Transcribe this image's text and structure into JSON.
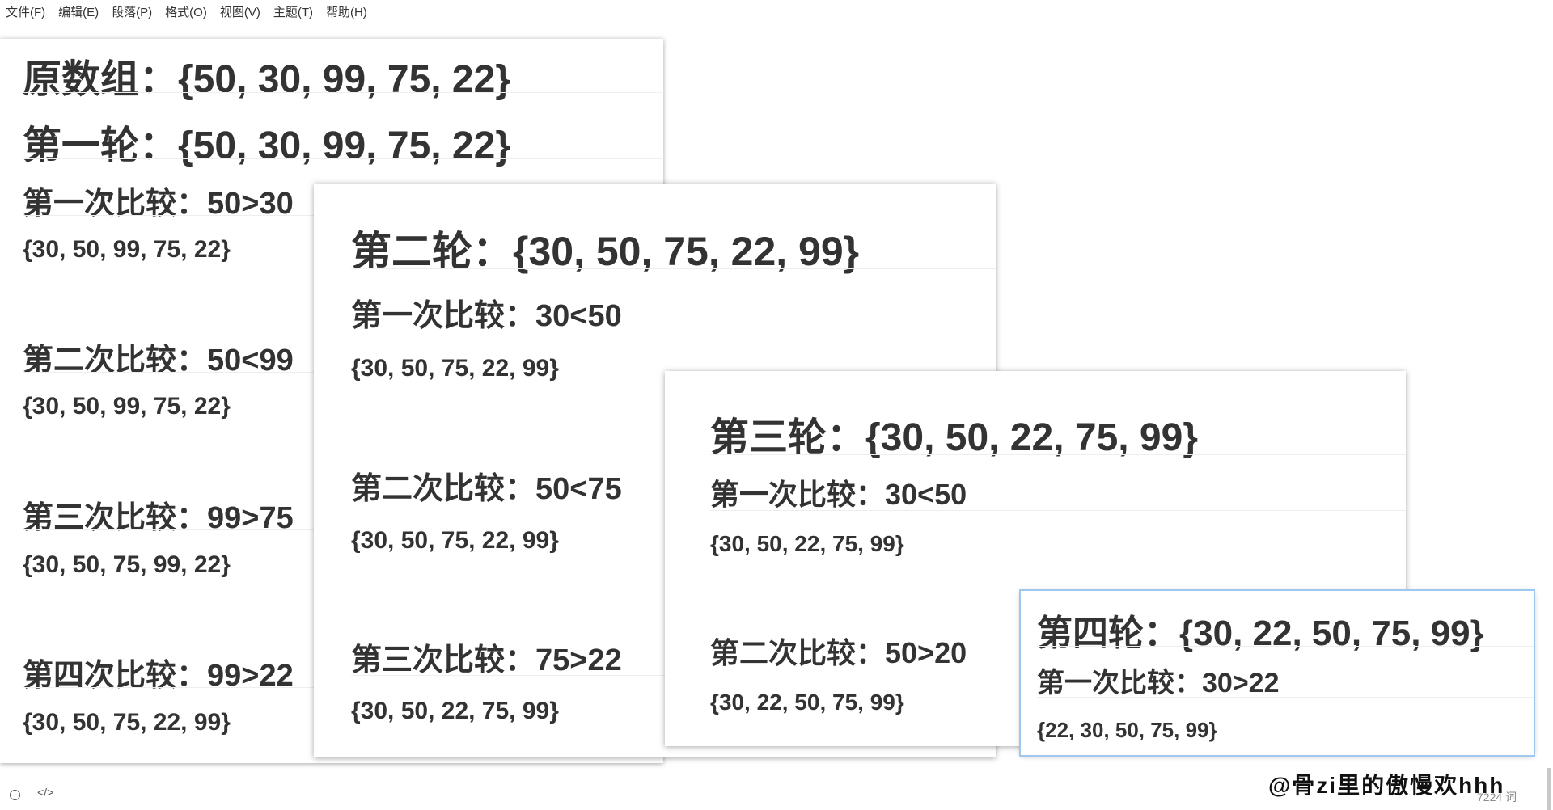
{
  "menu": [
    "文件(F)",
    "编辑(E)",
    "段落(P)",
    "格式(O)",
    "视图(V)",
    "主题(T)",
    "帮助(H)"
  ],
  "editor": {
    "heading_original": "原数组：{50, 30, 99, 75, 22}",
    "heading_round1": "第一轮：{50, 30, 99, 75, 22}",
    "compare1": "第一次比较：50>30",
    "result1": "{30, 50, 99, 75, 22}",
    "compare2": "第二次比较：50<99",
    "result2": "{30, 50, 99, 75, 22}",
    "compare3": "第三次比较：99>75",
    "result3": "{30, 50, 75, 99, 22}",
    "compare4": "第四次比较：99>22",
    "result4": "{30, 50, 75, 22, 99}"
  },
  "panel2": {
    "heading": "第二轮：{30, 50, 75, 22, 99}",
    "compare1": "第一次比较：30<50",
    "result1": "{30, 50, 75, 22, 99}",
    "compare2": "第二次比较：50<75",
    "result2": "{30, 50, 75, 22, 99}",
    "compare3": "第三次比较：75>22",
    "result3": "{30, 50, 22, 75, 99}"
  },
  "panel3": {
    "heading": "第三轮：{30, 50, 22, 75, 99}",
    "compare1": "第一次比较：30<50",
    "result1": "{30, 50, 22, 75, 99}",
    "compare2": "第二次比较：50>20",
    "result2": "{30, 22, 50, 75, 99}"
  },
  "panel4": {
    "heading": "第四轮：{30, 22, 50, 75, 99}",
    "compare1": "第一次比较：30>22",
    "result1": "{22, 30, 50, 75, 99}"
  },
  "status": {
    "code_icon": "</>",
    "word_count": "7224 词",
    "watermark": "@骨zi里的傲慢欢hhh"
  },
  "colors": {
    "text": "#333333",
    "selected_border": "#9ec8ee",
    "divider": "#eeeeee"
  }
}
